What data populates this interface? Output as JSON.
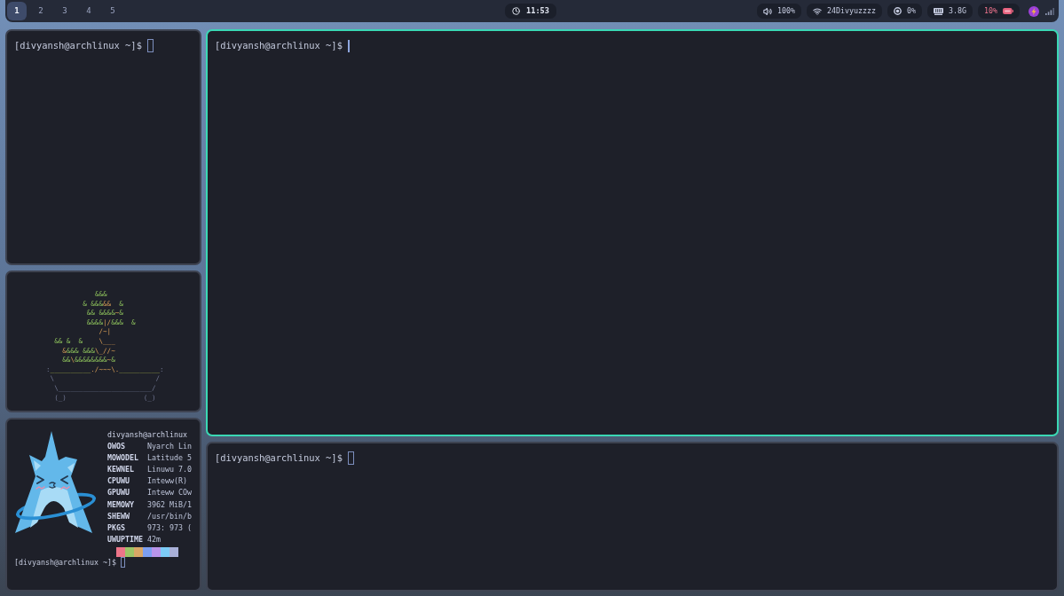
{
  "top_bar": {
    "workspaces": [
      {
        "label": "1",
        "selected": true
      },
      {
        "label": "2",
        "selected": false
      },
      {
        "label": "3",
        "selected": false
      },
      {
        "label": "4",
        "selected": false
      },
      {
        "label": "5",
        "selected": false
      }
    ],
    "clock": "11:53",
    "status": [
      {
        "kind": "volume",
        "text": "100%",
        "warning": false
      },
      {
        "kind": "wifi",
        "text": "24Divyuzzzz",
        "warning": false
      },
      {
        "kind": "cpu",
        "text": "0%",
        "warning": false
      },
      {
        "kind": "memory",
        "text": "3.8G",
        "warning": false
      },
      {
        "kind": "battery",
        "text": "10%",
        "warning": true
      }
    ]
  },
  "columns": [
    {
      "windows": [
        {
          "kind": "shell",
          "focused": false,
          "prompt": "[divyansh@archlinux ~]$"
        },
        {
          "kind": "bonsai",
          "focused": false,
          "art": [
            {
              "segments": [
                {
                  "text": "            &&&",
                  "kind": "leaf"
                }
              ]
            },
            {
              "segments": [
                {
                  "text": "         & &&&",
                  "kind": "leaf"
                },
                {
                  "text": "&&",
                  "kind": "twig"
                },
                {
                  "text": "  &",
                  "kind": "leaf"
                }
              ]
            },
            {
              "segments": [
                {
                  "text": "          && &&&&",
                  "kind": "leaf"
                },
                {
                  "text": "~",
                  "kind": "twig"
                },
                {
                  "text": "&",
                  "kind": "leaf"
                }
              ]
            },
            {
              "segments": [
                {
                  "text": "          &&&&",
                  "kind": "leaf"
                },
                {
                  "text": "|/",
                  "kind": "twig"
                },
                {
                  "text": "&&&  &",
                  "kind": "leaf"
                }
              ]
            },
            {
              "segments": [
                {
                  "text": "             /~|",
                  "kind": "twig"
                }
              ]
            },
            {
              "segments": [
                {
                  "text": "  && &  &",
                  "kind": "leaf"
                },
                {
                  "text": "    \\___",
                  "kind": "twig"
                }
              ]
            },
            {
              "segments": [
                {
                  "text": "    &",
                  "kind": "twig"
                },
                {
                  "text": "&&& &&&",
                  "kind": "leaf"
                },
                {
                  "text": "\\_//~",
                  "kind": "twig"
                }
              ]
            },
            {
              "segments": [
                {
                  "text": "    &&",
                  "kind": "leaf"
                },
                {
                  "text": "\\",
                  "kind": "twig"
                },
                {
                  "text": "&&&&&&&&",
                  "kind": "leaf"
                },
                {
                  "text": "~",
                  "kind": "twig"
                },
                {
                  "text": "&",
                  "kind": "leaf"
                }
              ]
            },
            {
              "segments": [
                {
                  "text": ":",
                  "kind": "pot"
                },
                {
                  "text": "__________",
                  "kind": "rim"
                },
                {
                  "text": "./~~~\\.",
                  "kind": "twig"
                },
                {
                  "text": "__________",
                  "kind": "rim"
                },
                {
                  "text": ":",
                  "kind": "pot"
                }
              ]
            },
            {
              "segments": [
                {
                  "text": " \\                         /",
                  "kind": "pot"
                }
              ]
            },
            {
              "segments": [
                {
                  "text": "  \\_______________________/",
                  "kind": "pot"
                }
              ]
            },
            {
              "segments": [
                {
                  "text": "  (_)                   (_)",
                  "kind": "pot"
                }
              ]
            }
          ]
        },
        {
          "kind": "fetch",
          "focused": false,
          "title": "divyansh@archlinux",
          "info": [
            {
              "label": "OWOS",
              "value": "Nyarch Lin"
            },
            {
              "label": "MOWODEL",
              "value": "Latitude 5"
            },
            {
              "label": "KEWNEL",
              "value": "Linuwu 7.0"
            },
            {
              "label": "CPUWU",
              "value": "Inteww(R)"
            },
            {
              "label": "GPUWU",
              "value": "Inteww COw"
            },
            {
              "label": "MEMOWY",
              "value": "3962 MiB/1"
            },
            {
              "label": "SHEWW",
              "value": "/usr/bin/b"
            },
            {
              "label": "PKGS",
              "value": "973: 973 ("
            },
            {
              "label": "UWUPTIME",
              "value": "42m"
            }
          ],
          "palette": [
            {
              "color": "#ec7589"
            },
            {
              "color": "#9cc466"
            },
            {
              "color": "#d8a766"
            },
            {
              "color": "#7d9ff0"
            },
            {
              "color": "#b995ea"
            },
            {
              "color": "#7ccbf6"
            },
            {
              "color": "#a9b0d8"
            }
          ],
          "prompt": "[divyansh@archlinux ~]$"
        }
      ]
    },
    {
      "windows": [
        {
          "kind": "shell",
          "focused": true,
          "prompt": "[divyansh@archlinux ~]$"
        },
        {
          "kind": "shell",
          "focused": false,
          "prompt": "[divyansh@archlinux ~]$"
        }
      ]
    }
  ]
}
